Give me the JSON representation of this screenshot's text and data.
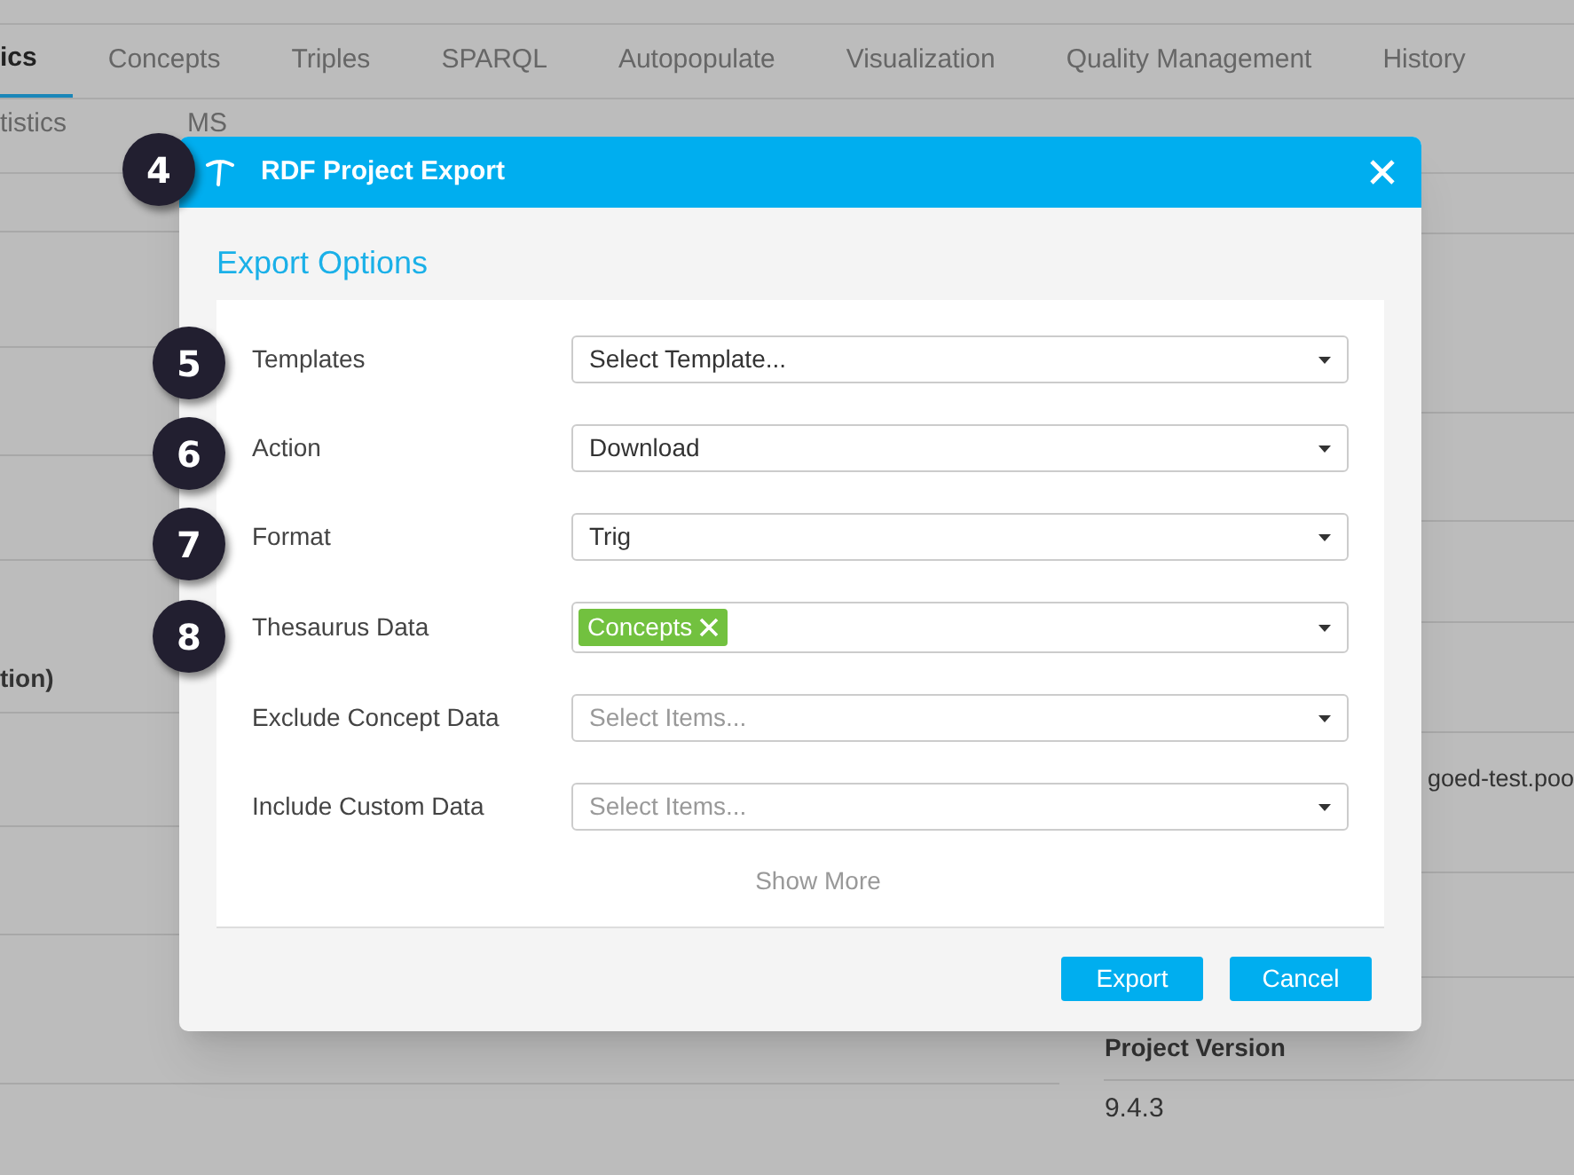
{
  "page": {
    "tabs": [
      {
        "label": "ics",
        "selected": true
      },
      {
        "label": "Concepts",
        "selected": false
      },
      {
        "label": "Triples",
        "selected": false
      },
      {
        "label": "SPARQL",
        "selected": false
      },
      {
        "label": "Autopopulate",
        "selected": false
      },
      {
        "label": "Visualization",
        "selected": false
      },
      {
        "label": "Quality Management",
        "selected": false
      },
      {
        "label": "History",
        "selected": false
      }
    ],
    "subtabs": [
      "tistics",
      "MS"
    ],
    "left_panel": {
      "heading": "tion)"
    },
    "right_panel": {
      "value_1": "goed-test.poo",
      "heading": "Project Version",
      "value_2": "9.4.3"
    }
  },
  "dialog": {
    "title": "RDF Project Export",
    "section_title": "Export Options",
    "fields": [
      {
        "label": "Templates",
        "value": "Select Template..."
      },
      {
        "label": "Action",
        "value": "Download"
      },
      {
        "label": "Format",
        "value": "Trig"
      },
      {
        "label": "Thesaurus Data",
        "tags": [
          "Concepts"
        ]
      },
      {
        "label": "Exclude Concept Data",
        "placeholder": "Select Items..."
      },
      {
        "label": "Include Custom Data",
        "placeholder": "Select Items..."
      }
    ],
    "show_more": "Show More",
    "buttons": [
      "Export",
      "Cancel"
    ]
  },
  "callouts": [
    "4",
    "5",
    "6",
    "7",
    "8"
  ]
}
